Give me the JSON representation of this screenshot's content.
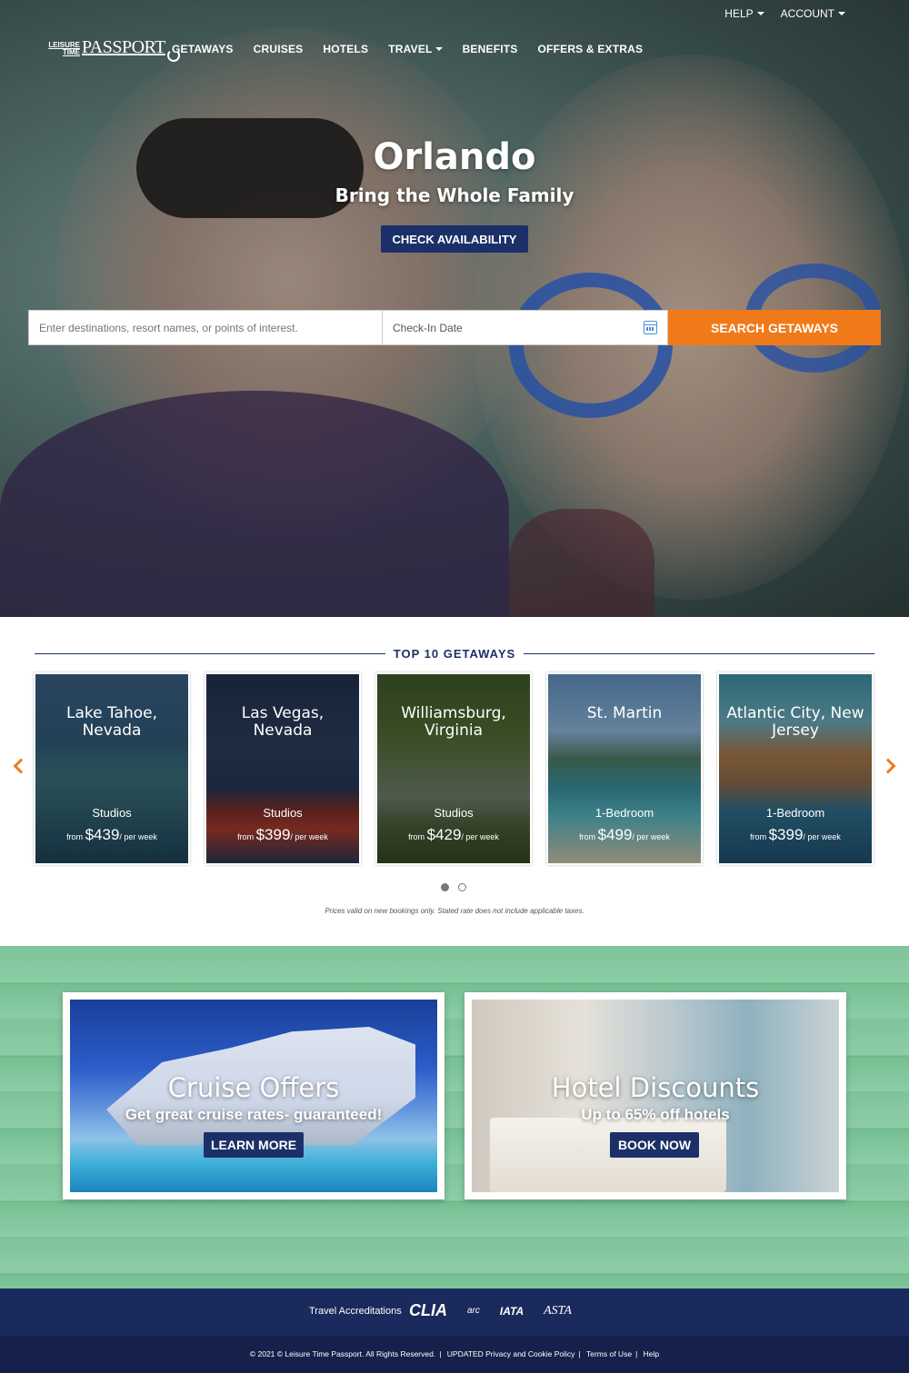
{
  "brand": {
    "logo_small": "LEISURE TIME",
    "logo_big": "PASSPORT"
  },
  "topnav": {
    "help": "HELP",
    "account": "ACCOUNT"
  },
  "mainnav": [
    "GETAWAYS",
    "CRUISES",
    "HOTELS",
    "TRAVEL",
    "BENEFITS",
    "OFFERS & EXTRAS"
  ],
  "hero": {
    "title": "Orlando",
    "subtitle": "Bring the Whole Family",
    "cta": "CHECK AVAILABILITY"
  },
  "search": {
    "destination_placeholder": "Enter destinations, resort names, or points of interest.",
    "date_placeholder": "Check-In Date",
    "button": "SEARCH GETAWAYS"
  },
  "top10": {
    "heading": "TOP 10 GETAWAYS",
    "cards": [
      {
        "name": "Lake Tahoe, Nevada",
        "unit": "Studios",
        "from": "from",
        "price": "$439",
        "per": "/ per week"
      },
      {
        "name": "Las Vegas, Nevada",
        "unit": "Studios",
        "from": "from",
        "price": "$399",
        "per": "/ per week"
      },
      {
        "name": "Williamsburg, Virginia",
        "unit": "Studios",
        "from": "from",
        "price": "$429",
        "per": "/ per week"
      },
      {
        "name": "St. Martin",
        "unit": "1-Bedroom",
        "from": "from",
        "price": "$499",
        "per": "/ per week"
      },
      {
        "name": "Atlantic City, New Jersey",
        "unit": "1-Bedroom",
        "from": "from",
        "price": "$399",
        "per": "/ per week"
      }
    ],
    "disclaimer": "Prices valid on new bookings only. Stated rate does not include applicable taxes."
  },
  "promos": [
    {
      "title": "Cruise Offers",
      "subtitle": "Get great cruise rates- guaranteed!",
      "button": "LEARN MORE"
    },
    {
      "title": "Hotel Discounts",
      "subtitle": "Up to 65% off hotels",
      "button": "BOOK NOW"
    }
  ],
  "accreditations": {
    "label": "Travel Accreditations",
    "logos": [
      "CLIA",
      "arc",
      "IATA",
      "ASTA"
    ]
  },
  "footer": {
    "copyright": "© 2021 © Leisure Time Passport. All Rights Reserved.",
    "privacy": "UPDATED Privacy and Cookie Policy",
    "terms": "Terms of Use",
    "help": "Help"
  },
  "colors": {
    "navy": "#1b3068",
    "orange": "#f07a1a",
    "footer": "#1b2a5c"
  }
}
